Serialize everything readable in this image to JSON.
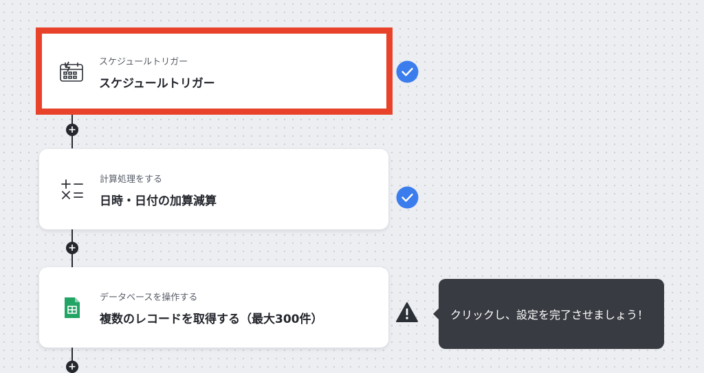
{
  "steps": [
    {
      "subtitle": "スケジュールトリガー",
      "title": "スケジュールトリガー",
      "icon": "calendar-clock-icon",
      "status": "complete"
    },
    {
      "subtitle": "計算処理をする",
      "title": "日時・日付の加算減算",
      "icon": "calculator-operators-icon",
      "status": "complete"
    },
    {
      "subtitle": "データベースを操作する",
      "title": "複数のレコードを取得する（最大300件）",
      "icon": "google-sheets-icon",
      "status": "warning"
    }
  ],
  "tooltip": {
    "text": "クリックし、設定を完了させましょう！"
  },
  "add_button": {
    "symbol": "+"
  },
  "colors": {
    "selected_border": "#e8432a",
    "check_blue": "#3b7ded",
    "warning": "#2b2f36",
    "tooltip_bg": "#383b41",
    "sheets_green": "#21a464"
  }
}
